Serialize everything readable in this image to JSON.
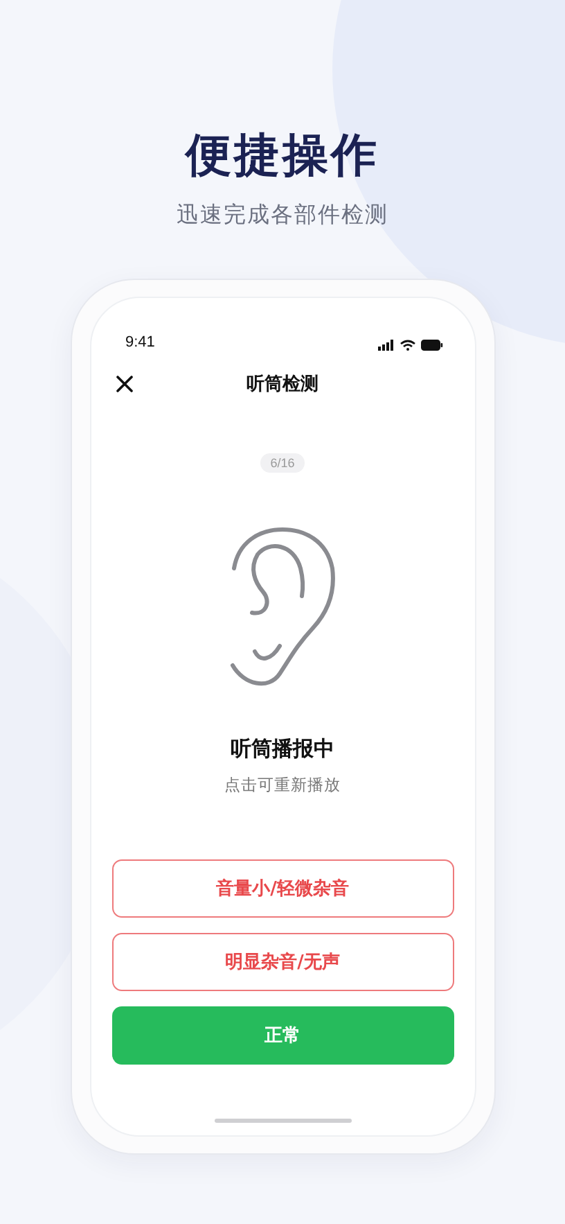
{
  "headline": "便捷操作",
  "subheadline": "迅速完成各部件检测",
  "status_bar": {
    "time": "9:41"
  },
  "nav": {
    "title": "听筒检测"
  },
  "progress": "6/16",
  "status": {
    "title": "听筒播报中",
    "hint": "点击可重新播放"
  },
  "actions": [
    {
      "kind": "outline",
      "label": "音量小/轻微杂音"
    },
    {
      "kind": "outline",
      "label": "明显杂音/无声"
    },
    {
      "kind": "primary",
      "label": "正常"
    }
  ]
}
